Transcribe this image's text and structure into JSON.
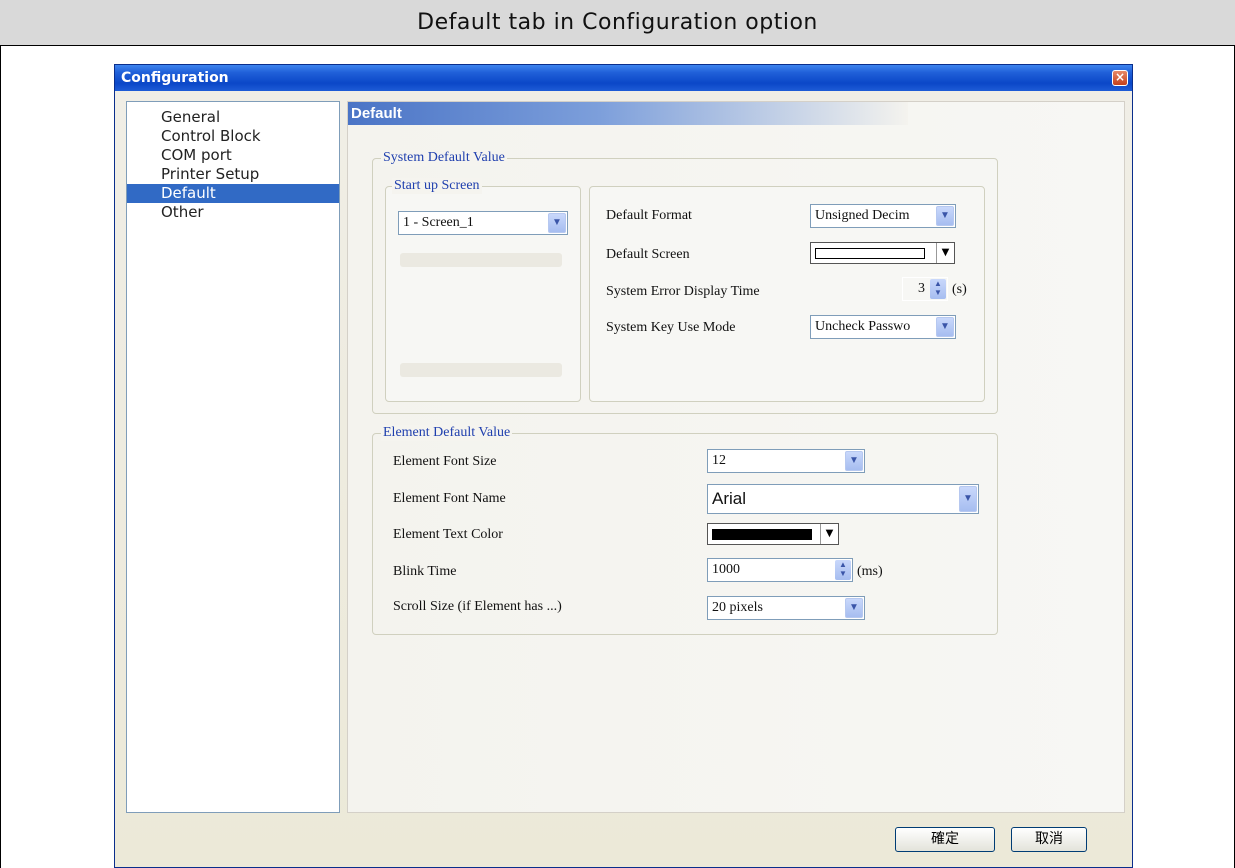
{
  "caption": "Default tab in Configuration option",
  "window": {
    "title": "Configuration",
    "close_icon": "close-icon"
  },
  "nav": {
    "items": [
      {
        "label": "General"
      },
      {
        "label": "Control Block"
      },
      {
        "label": "COM port"
      },
      {
        "label": "Printer Setup"
      },
      {
        "label": "Default",
        "selected": true
      },
      {
        "label": "Other"
      }
    ]
  },
  "content": {
    "header": "Default",
    "system_default": {
      "title": "System Default Value",
      "startup": {
        "title": "Start up Screen",
        "value": "1 - Screen_1"
      },
      "default_format": {
        "label": "Default Format",
        "value": "Unsigned Decim"
      },
      "default_screen": {
        "label": "Default Screen"
      },
      "error_time": {
        "label": "System Error Display Time",
        "value": "3",
        "unit": "(s)"
      },
      "key_mode": {
        "label": "System Key Use Mode",
        "value": "Uncheck Passwo"
      }
    },
    "element_default": {
      "title": "Element Default Value",
      "font_size": {
        "label": "Element Font Size",
        "value": "12"
      },
      "font_name": {
        "label": "Element Font Name",
        "value": "Arial"
      },
      "text_color": {
        "label": "Element Text Color",
        "color": "#000000"
      },
      "blink_time": {
        "label": "Blink Time",
        "value": "1000",
        "unit": "(ms)"
      },
      "scroll_size": {
        "label": "Scroll Size (if Element has ...)",
        "value": "20 pixels"
      }
    }
  },
  "buttons": {
    "ok": "確定",
    "cancel": "取消"
  }
}
